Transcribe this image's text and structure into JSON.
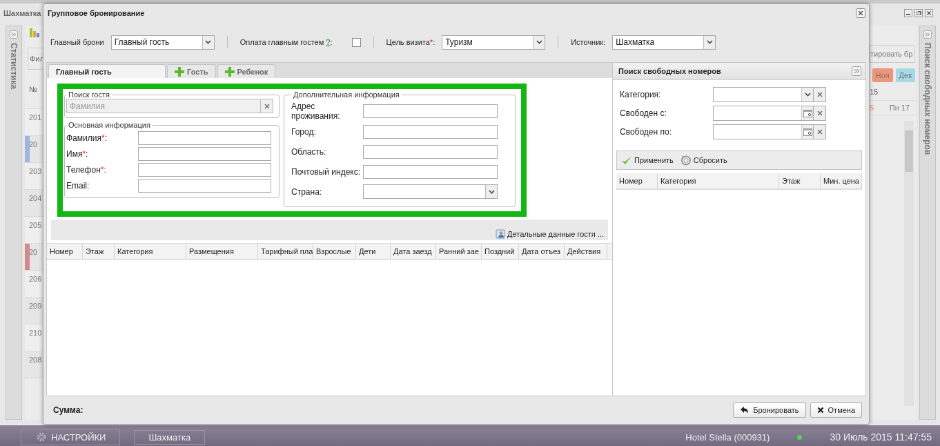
{
  "app": {
    "title": "Шахматка",
    "stats_panel": "Статистика",
    "filter_button": "Фил",
    "number_header": "№",
    "rooms": [
      {
        "number": "201"
      },
      {
        "number": "20",
        "color": "#9fb4de"
      },
      {
        "number": "203"
      },
      {
        "number": "204"
      },
      {
        "number": "205"
      },
      {
        "number": "20",
        "color": "#d48a8a"
      },
      {
        "number": "206"
      },
      {
        "number": "209"
      },
      {
        "number": "210"
      },
      {
        "number": "208"
      }
    ],
    "edit_button": "тировать бр",
    "months": [
      {
        "label": "Ноя",
        "color": "#f0957a"
      },
      {
        "label": "Дек",
        "color": "#a6d8e6"
      }
    ],
    "date_header": "15",
    "days": [
      {
        "label": "5",
        "weekend": true
      },
      {
        "label": "Пн 17",
        "weekend": false
      }
    ],
    "rooms_panel": "Поиск свободных номеров"
  },
  "taskbar": {
    "items": [
      {
        "label": "НАСТРОЙКИ",
        "kind": "settings"
      },
      {
        "label": "Шахматка",
        "kind": "plain"
      }
    ],
    "hotel": "Hotel Stella (000931)",
    "online": true,
    "datetime": "30 Июль 2015 11:47:55"
  },
  "dialog": {
    "title": "Групповое бронирование",
    "toolbar": [
      {
        "kind": "select",
        "label": "Главный брони",
        "value": "Главный гость"
      },
      {
        "kind": "checkbox",
        "label": "Оплата главным гостем ",
        "help": "?",
        "colon": ":",
        "checked": false
      },
      {
        "kind": "select",
        "label": "Цель визита",
        "mark": "*",
        "colon": ":",
        "value": "Туризм"
      },
      {
        "kind": "select",
        "label": "Источник:",
        "value": "Шахматка"
      }
    ],
    "tabs": [
      {
        "label": "Главный гость",
        "kind": "plain",
        "selected": true
      },
      {
        "label": "Гость",
        "kind": "add",
        "selected": false
      },
      {
        "label": "Ребенок",
        "kind": "add",
        "selected": false
      }
    ],
    "guest_search": {
      "legend": "Поиск гостя",
      "placeholder": "Фамилия"
    },
    "main_info": {
      "legend": "Основная информация",
      "fields": [
        {
          "label": "Фамилия",
          "mark": "*",
          "colon": ":"
        },
        {
          "label": "Имя",
          "mark": "*",
          "colon": ":"
        },
        {
          "label": "Телефон",
          "mark": "*",
          "colon": ":"
        },
        {
          "label": "Email",
          "colon": ":"
        }
      ]
    },
    "extra_info": {
      "legend": "Дополнительная информация",
      "fields": [
        {
          "label": "Адрес проживания:",
          "kind": "text"
        },
        {
          "label": "Город:",
          "kind": "text"
        },
        {
          "label": "Область:",
          "kind": "text"
        },
        {
          "label": "Почтовый индекс:",
          "kind": "text"
        },
        {
          "label": "Страна:",
          "kind": "select"
        }
      ]
    },
    "details_link": "Детальные данные гостя ...",
    "columns": [
      "Номер",
      "Этаж",
      "Категория",
      "Размещения",
      "Тарифный пла",
      "Взрослые",
      "Дети",
      "Дата заезд",
      "Ранний зае",
      "Поздний",
      "Дата отъез",
      "Действия"
    ],
    "room_search": {
      "title": "Поиск свободных номеров",
      "fields": [
        {
          "label": "Категория:",
          "kind": "select"
        },
        {
          "label": "Свободен с:",
          "kind": "date"
        },
        {
          "label": "Свободен по:",
          "kind": "date"
        }
      ],
      "apply": "Применить",
      "reset": "Сбросить",
      "columns": [
        "Номер",
        "Категория",
        "Этаж",
        "Мин. цена"
      ]
    },
    "total_label": "Сумма:",
    "book_button": "Бронировать",
    "cancel_button": "Отмена"
  }
}
